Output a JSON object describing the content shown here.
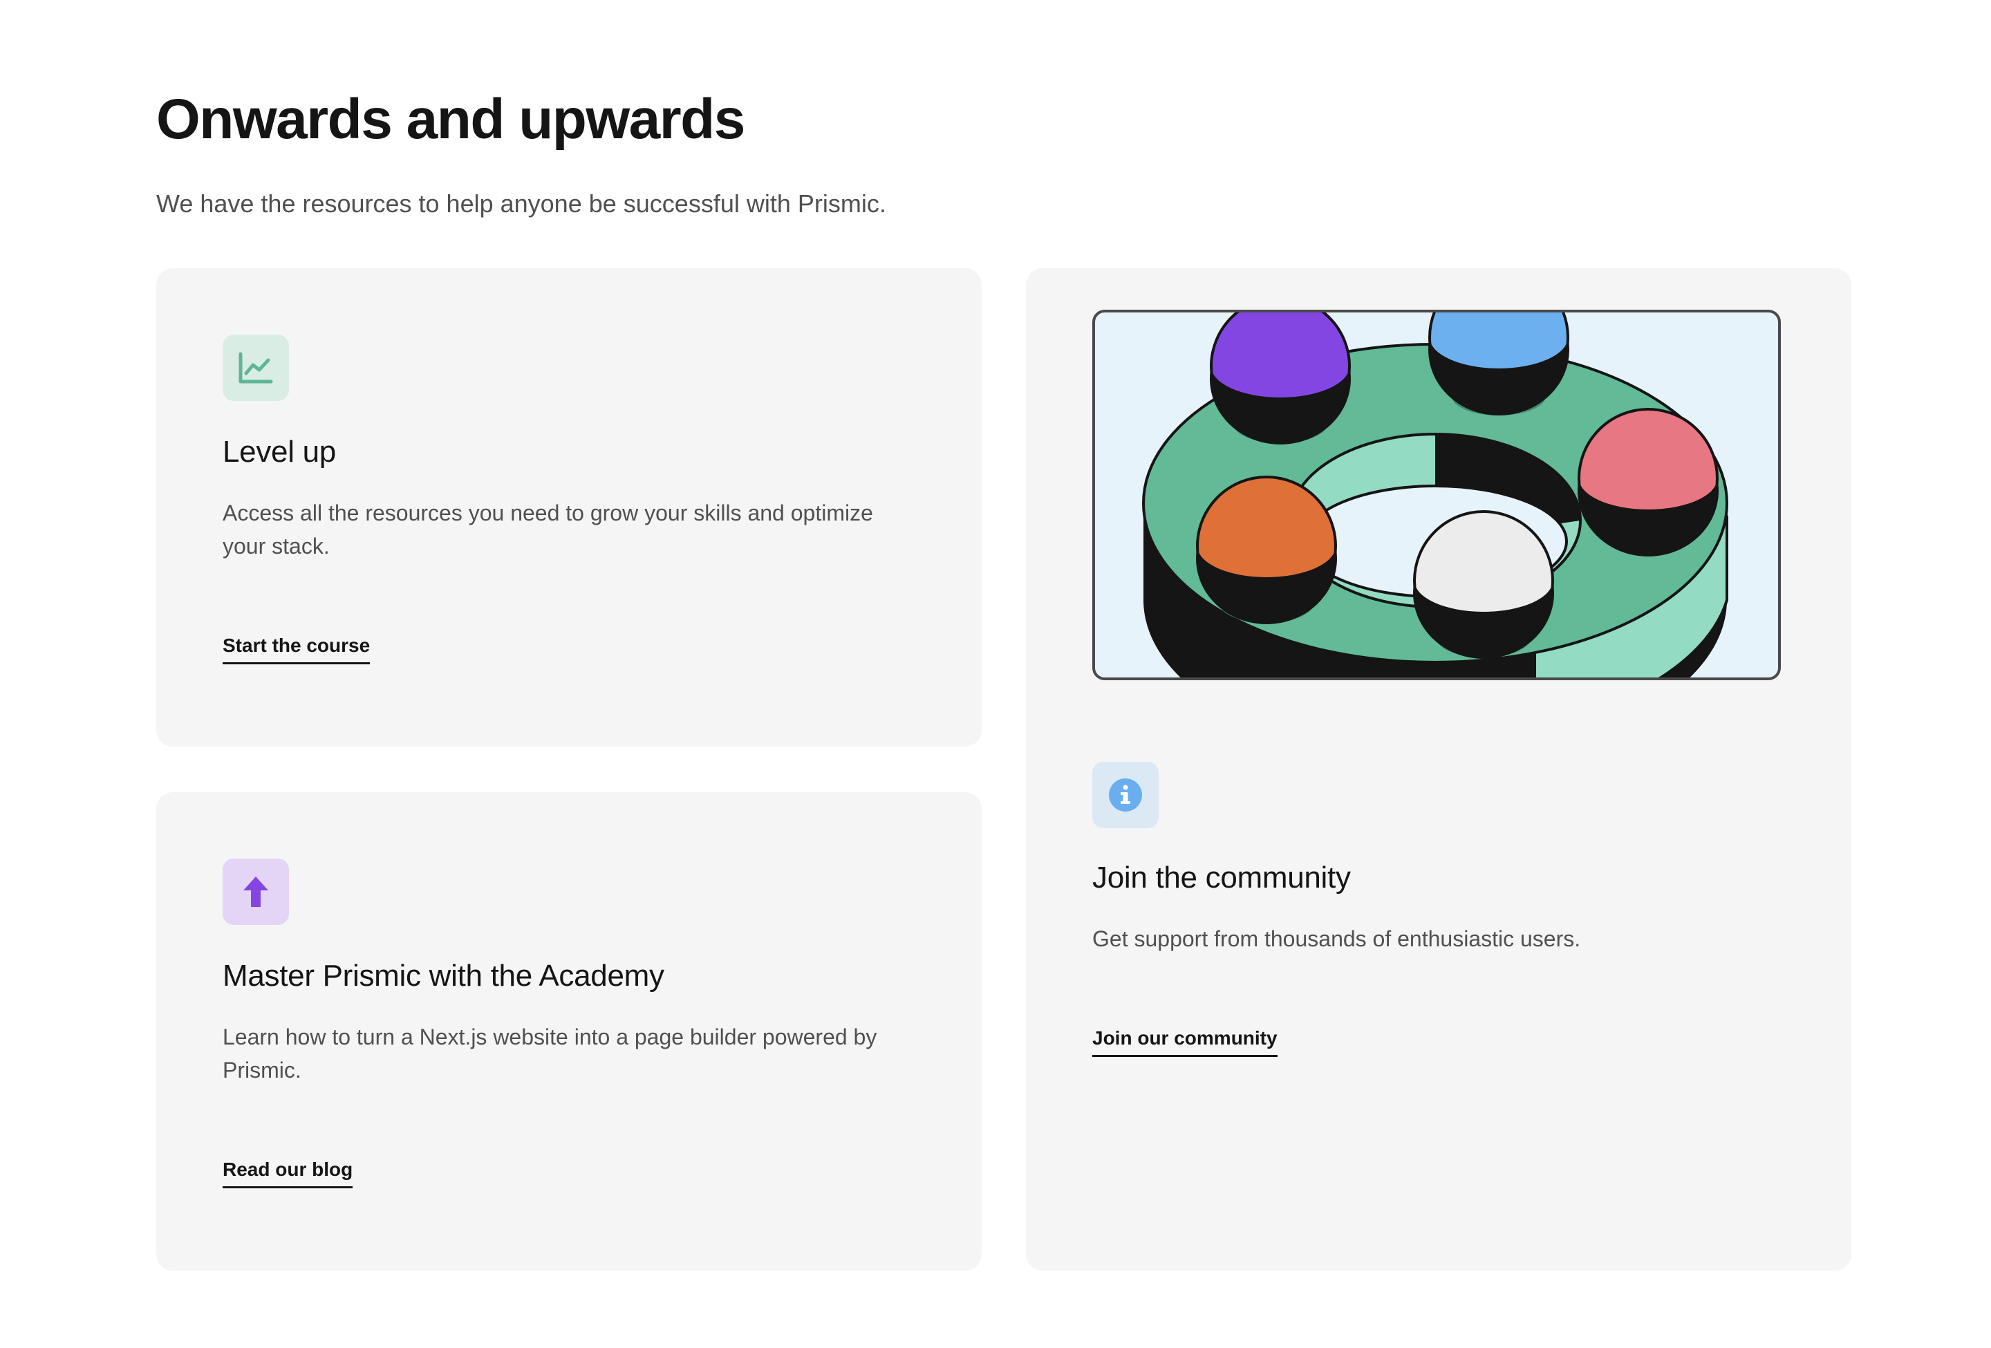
{
  "header": {
    "title": "Onwards and upwards",
    "subtitle": "We have the resources to help anyone be successful with Prismic."
  },
  "cards": [
    {
      "id": "level-up",
      "icon": "chart-line-icon",
      "icon_color": "#5fb597",
      "icon_bg": "#d9ede4",
      "title": "Level up",
      "description": "Access all the resources you need to grow your skills and optimize your stack.",
      "link_label": "Start the course"
    },
    {
      "id": "academy",
      "icon": "arrow-up-icon",
      "icon_color": "#8446e3",
      "icon_bg": "#e4d5f6",
      "title": "Master Prismic with the Academy",
      "description": "Learn how to turn a Next.js website into a page builder powered by Prismic.",
      "link_label": "Read our blog"
    },
    {
      "id": "community",
      "icon": "info-icon",
      "icon_color": "#6aaeef",
      "icon_bg": "#dbe9f5",
      "title": "Join the community",
      "description": "Get support from thousands of enthusiastic users.",
      "link_label": "Join our community"
    }
  ],
  "colors": {
    "card_bg": "#f5f5f5",
    "illus_bg": "#e6f3fb",
    "ring_green": "#62ba97",
    "ring_light_green": "#93dcc3",
    "ball_purple": "#8446e3",
    "ball_blue": "#6db0ef",
    "ball_red": "#e77782",
    "ball_orange": "#df7038",
    "ball_white": "#ececec"
  }
}
